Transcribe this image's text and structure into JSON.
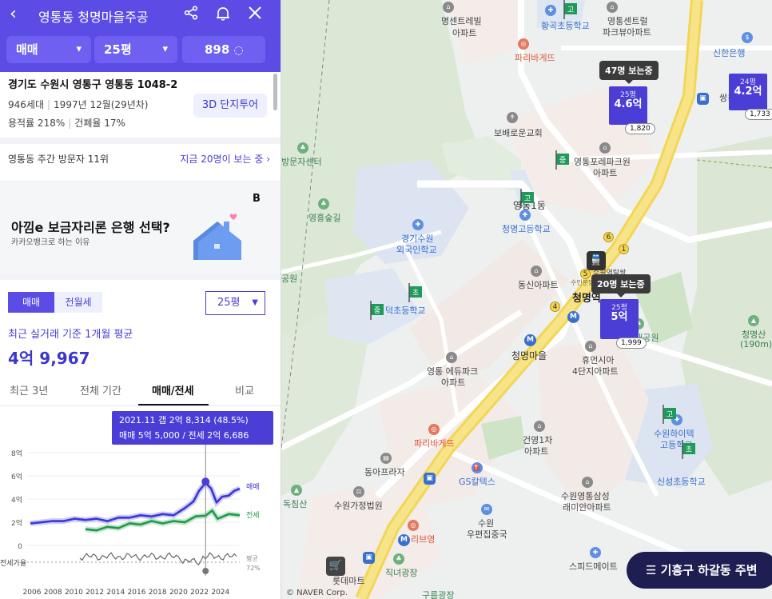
{
  "header": {
    "title": "영통동 청명마을주공",
    "trade_type": "매매",
    "size": "25평",
    "count": "898"
  },
  "complex": {
    "address": "경기도 수원시 영통구 영통동 1048-2",
    "households": "946세대",
    "built": "1997년 12월(29년차)",
    "floor_area_ratio": "용적률 218%",
    "coverage_ratio": "건폐율 17%",
    "tour_button": "3D 단지투어"
  },
  "visitors": {
    "rank": "영통동 주간 방문자 11위",
    "now_watching": "지금 20명이 보는 중"
  },
  "ad": {
    "headline": "아낌e 보금자리론 은행 선택?",
    "sub": "카카오뱅크로 하는 이유",
    "logo": "B"
  },
  "price": {
    "btn_sale": "매매",
    "btn_lease": "전월세",
    "size_select": "25평",
    "avg_label": "최근 실거래 기준 1개월 평균",
    "avg_value": "4억 9,967"
  },
  "tabs": [
    "최근 3년",
    "전체 기간",
    "매매/전세",
    "비교"
  ],
  "chart_data": {
    "type": "line",
    "tooltip_line1": "2021.11  갭 2억 8,314 (48.5%)",
    "tooltip_line2": "매매 5억 5,000 / 전세 2억 6,686",
    "x_ticks": [
      "2006",
      "2008",
      "2010",
      "2012",
      "2014",
      "2016",
      "2018",
      "2020",
      "2022",
      "2024"
    ],
    "y_ticks": [
      "8억",
      "6억",
      "4억",
      "2억",
      "0"
    ],
    "ylim": [
      0,
      9
    ],
    "lower_label": "전세가율",
    "lower_right_label_1": "평균",
    "lower_right_label_2": "72%",
    "series": [
      {
        "name": "매매",
        "color": "#3d36d6",
        "x": [
          2006,
          2007,
          2008,
          2009,
          2010,
          2011,
          2012,
          2013,
          2014,
          2015,
          2016,
          2017,
          2018,
          2019,
          2020,
          2020.8,
          2021.3,
          2021.9,
          2022.4,
          2022.9,
          2023.4,
          2024,
          2024.5,
          2025
        ],
        "values": [
          1.8,
          2.1,
          2.0,
          2.2,
          2.2,
          2.3,
          2.2,
          2.2,
          2.3,
          2.5,
          2.5,
          2.6,
          2.6,
          2.7,
          3.1,
          3.9,
          4.6,
          5.5,
          4.8,
          3.8,
          4.1,
          4.4,
          4.6,
          5.0
        ]
      },
      {
        "name": "전세",
        "color": "#1e9a4a",
        "x": [
          2011,
          2012,
          2013,
          2014,
          2015,
          2016,
          2017,
          2018,
          2019,
          2020,
          2021,
          2021.9,
          2022.5,
          2023,
          2024,
          2025
        ],
        "values": [
          1.3,
          1.4,
          1.5,
          1.6,
          1.8,
          1.9,
          2.0,
          2.0,
          2.0,
          2.1,
          2.4,
          2.67,
          2.9,
          2.4,
          2.6,
          2.7
        ]
      }
    ],
    "marker_x": 2021.9
  },
  "map": {
    "labels": [
      {
        "t": "명센트레빌",
        "c": ""
      },
      {
        "t": "아파트",
        "c": ""
      },
      {
        "t": "황곡초등학교",
        "c": "blue"
      },
      {
        "t": "영통센트럴",
        "c": ""
      },
      {
        "t": "파크뷰아파트",
        "c": ""
      },
      {
        "t": "신한은행",
        "c": "blue"
      },
      {
        "t": "파리바게뜨",
        "c": "red"
      },
      {
        "t": "보배로운교회",
        "c": ""
      },
      {
        "t": "영통포레파크원",
        "c": ""
      },
      {
        "t": "아파트",
        "c": ""
      },
      {
        "t": "방문자센터",
        "c": "green"
      },
      {
        "t": "영흥숲길",
        "c": "green"
      },
      {
        "t": "경기수원",
        "c": "blue"
      },
      {
        "t": "외국인학교",
        "c": "blue"
      },
      {
        "t": "영통1동",
        "c": "mid"
      },
      {
        "t": "청명고등학교",
        "c": "blue"
      },
      {
        "t": "공원",
        "c": "green"
      },
      {
        "t": "동신아파트",
        "c": ""
      },
      {
        "t": "덕초등학교",
        "c": "blue"
      },
      {
        "t": "청명역",
        "c": "big"
      },
      {
        "t": "생태공원",
        "c": "green"
      },
      {
        "t": "청명산",
        "c": "green"
      },
      {
        "t": "(190m)",
        "c": "green"
      },
      {
        "t": "청명마을",
        "c": "mid"
      },
      {
        "t": "휴먼시아",
        "c": ""
      },
      {
        "t": "4단지아파트",
        "c": ""
      },
      {
        "t": "영통 에듀파크",
        "c": ""
      },
      {
        "t": "아파트",
        "c": ""
      },
      {
        "t": "수원하이텍",
        "c": "blue"
      },
      {
        "t": "고등학교",
        "c": "blue"
      },
      {
        "t": "신성초등학교",
        "c": "blue"
      },
      {
        "t": "파리바게뜨",
        "c": "red"
      },
      {
        "t": "건영1차",
        "c": ""
      },
      {
        "t": "아파트",
        "c": ""
      },
      {
        "t": "동아프라자",
        "c": ""
      },
      {
        "t": "GS칼텍스",
        "c": "blue"
      },
      {
        "t": "독침산",
        "c": "green"
      },
      {
        "t": "수원가정법원",
        "c": ""
      },
      {
        "t": "수원",
        "c": ""
      },
      {
        "t": "우편집중국",
        "c": ""
      },
      {
        "t": "수원영통삼성",
        "c": ""
      },
      {
        "t": "래미안아파트",
        "c": ""
      },
      {
        "t": "리브영",
        "c": "red"
      },
      {
        "t": "롯데마트",
        "c": ""
      },
      {
        "t": "직녀광장",
        "c": "green"
      },
      {
        "t": "스피드메이트",
        "c": ""
      },
      {
        "t": "구름광장",
        "c": "green"
      },
      {
        "t": "수원역탈쌍",
        "c": ""
      },
      {
        "t": "수인분당",
        "c": ""
      },
      {
        "t": "쌍용",
        "c": ""
      }
    ],
    "markers": [
      {
        "py": "25평",
        "price": "4.6억",
        "count": "1,820"
      },
      {
        "py": "24평",
        "price": "4.2억",
        "count": "1,733"
      },
      {
        "py": "25평",
        "price": "5억",
        "count": "1,999"
      }
    ],
    "tips": [
      "47명 보는중",
      "20명 보는중"
    ],
    "school_flags": [
      "고",
      "중",
      "고",
      "중",
      "초",
      "고",
      "초"
    ],
    "nearby_button": "☰ 기흥구 하갈동 주변",
    "copyright": "© NAVER Corp.",
    "numbers": [
      "5",
      "1",
      "6",
      "4"
    ]
  }
}
